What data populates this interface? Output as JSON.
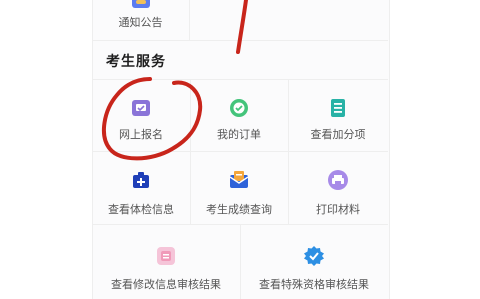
{
  "top": {
    "notice_label": "通知公告"
  },
  "section": {
    "title": "考生服务"
  },
  "services": {
    "online_registration": "网上报名",
    "my_orders": "我的订单",
    "view_bonus_points": "查看加分项",
    "view_medical_info": "查看体检信息",
    "score_query": "考生成绩查询",
    "print_materials": "打印材料",
    "view_modify_review": "查看修改信息审核结果",
    "view_special_review": "查看特殊资格审核结果"
  },
  "icons": {
    "notice": "notice-icon",
    "online_registration": "registration-icon",
    "my_orders": "order-icon",
    "view_bonus_points": "document-list-icon",
    "view_medical_info": "medical-kit-icon",
    "score_query": "score-mail-icon",
    "print_materials": "printer-icon",
    "view_modify_review": "modify-review-icon",
    "view_special_review": "badge-check-icon"
  },
  "colors": {
    "annotation_red": "#c8251b",
    "text": "#555555",
    "title": "#1f1f1f",
    "border": "#eeeeee"
  }
}
